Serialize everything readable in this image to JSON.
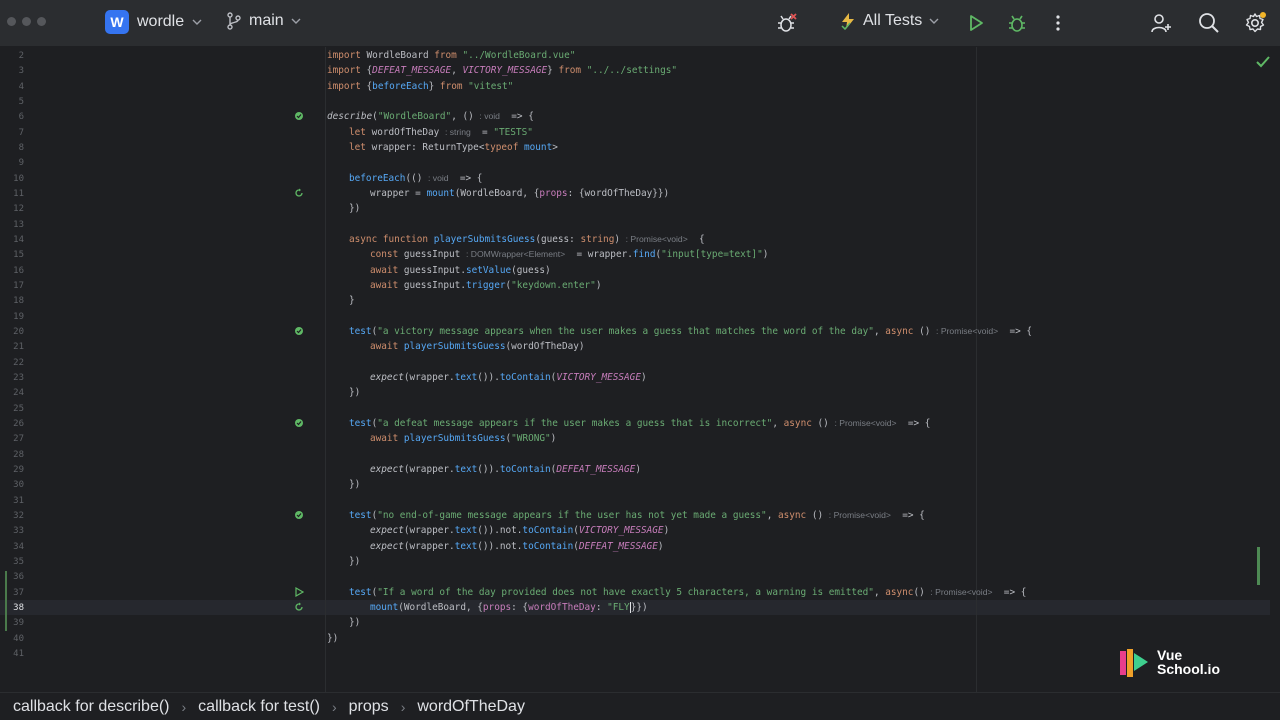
{
  "toolbar": {
    "project_badge": "W",
    "project_name": "wordle",
    "branch_name": "main",
    "run_config": "All Tests"
  },
  "editor": {
    "line_numbers": [
      "2",
      "3",
      "4",
      "5",
      "6",
      "7",
      "8",
      "9",
      "10",
      "11",
      "12",
      "13",
      "14",
      "15",
      "16",
      "17",
      "18",
      "19",
      "20",
      "21",
      "22",
      "23",
      "24",
      "25",
      "26",
      "27",
      "28",
      "29",
      "30",
      "31",
      "32",
      "33",
      "34",
      "35",
      "36",
      "37",
      "38",
      "39",
      "40",
      "41"
    ],
    "current_line": "38",
    "lines": {
      "l2": [
        "import",
        " WordleBoard ",
        "from",
        " \"../WordleBoard.vue\""
      ],
      "l3": [
        "import",
        " {",
        "DEFEAT_MESSAGE",
        ", ",
        "VICTORY_MESSAGE",
        "} ",
        "from",
        " \"../../settings\""
      ],
      "l4": [
        "import",
        " {",
        "beforeEach",
        "} ",
        "from",
        " \"vitest\""
      ],
      "l6": [
        "describe",
        "(",
        "\"WordleBoard\"",
        ", () ",
        ": void",
        "  => {"
      ],
      "l7": [
        "let",
        " wordOfTheDay ",
        ": string",
        "  = ",
        "\"TESTS\""
      ],
      "l8": [
        "let",
        " wrapper: ReturnType<",
        "typeof",
        " ",
        "mount",
        ">"
      ],
      "l10": [
        "beforeEach",
        "(() ",
        ": void",
        "  => {"
      ],
      "l11": [
        "wrapper = ",
        "mount",
        "(WordleBoard, {",
        "props",
        ": {wordOfTheDay}})"
      ],
      "l12": [
        "})"
      ],
      "l14": [
        "async",
        " ",
        "function",
        " ",
        "playerSubmitsGuess",
        "(guess: ",
        "string",
        ") ",
        ": Promise<void>",
        "  {"
      ],
      "l15": [
        "const",
        " guessInput ",
        ": DOMWrapper<Element>",
        "  = wrapper.",
        "find",
        "(",
        "\"input[type=text]\"",
        ")"
      ],
      "l16": [
        "await",
        " guessInput.",
        "setValue",
        "(guess)"
      ],
      "l17": [
        "await",
        " guessInput.",
        "trigger",
        "(",
        "\"keydown.enter\"",
        ")"
      ],
      "l18": [
        "}"
      ],
      "l20": [
        "test",
        "(",
        "\"a victory message appears when the user makes a guess that matches the word of the day\"",
        ", ",
        "async",
        " () ",
        ": Promise<void>",
        "  => {"
      ],
      "l21": [
        "await",
        " ",
        "playerSubmitsGuess",
        "(wordOfTheDay)"
      ],
      "l23": [
        "expect",
        "(wrapper.",
        "text",
        "()).",
        "toContain",
        "(",
        "VICTORY_MESSAGE",
        ")"
      ],
      "l24": [
        "})"
      ],
      "l26": [
        "test",
        "(",
        "\"a defeat message appears if the user makes a guess that is incorrect\"",
        ", ",
        "async",
        " () ",
        ": Promise<void>",
        "  => {"
      ],
      "l27": [
        "await",
        " ",
        "playerSubmitsGuess",
        "(",
        "\"WRONG\"",
        ")"
      ],
      "l29": [
        "expect",
        "(wrapper.",
        "text",
        "()).",
        "toContain",
        "(",
        "DEFEAT_MESSAGE",
        ")"
      ],
      "l30": [
        "})"
      ],
      "l32": [
        "test",
        "(",
        "\"no end-of-game message appears if the user has not yet made a guess\"",
        ", ",
        "async",
        " () ",
        ": Promise<void>",
        "  => {"
      ],
      "l33": [
        "expect",
        "(wrapper.",
        "text",
        "()).not.",
        "toContain",
        "(",
        "VICTORY_MESSAGE",
        ")"
      ],
      "l34": [
        "expect",
        "(wrapper.",
        "text",
        "()).not.",
        "toContain",
        "(",
        "DEFEAT_MESSAGE",
        ")"
      ],
      "l35": [
        "})"
      ],
      "l37": [
        "test",
        "(",
        "\"If a word of the day provided does not have exactly 5 characters, a warning is emitted\"",
        ", ",
        "async",
        "() ",
        ": Promise<void>",
        "  => {"
      ],
      "l38": [
        "mount",
        "(WordleBoard, {",
        "props",
        ": {",
        "wordOfTheDay",
        ": ",
        "\"FLY",
        "",
        "}})"
      ],
      "l39": [
        "})"
      ],
      "l40": [
        "})"
      ]
    }
  },
  "breadcrumbs": [
    "callback for describe()",
    "callback for test()",
    "props",
    "wordOfTheDay"
  ],
  "logo": {
    "line1": "Vue",
    "line2": "School.io"
  },
  "colors": {
    "toolbar_bg": "#2b2d30",
    "editor_bg": "#1e1f22",
    "keyword": "#cf8e6d",
    "string": "#6aab73",
    "function": "#56a8f5",
    "constant": "#c77dbb",
    "accent": "#3574f0",
    "run_green": "#5fb865"
  }
}
